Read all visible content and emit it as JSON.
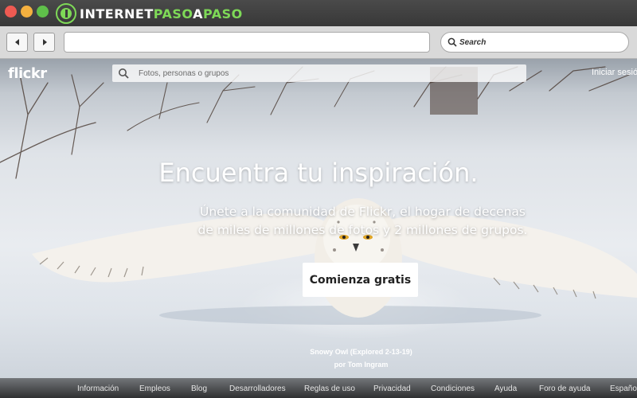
{
  "brand": {
    "name_part1": "INTERNET",
    "name_part2": "PASO",
    "name_part3": "A",
    "name_part4": "PASO",
    "accent_color": "#7ed957"
  },
  "browser": {
    "search_placeholder": "Search"
  },
  "flickr": {
    "logo": "flickr",
    "search_placeholder": "Fotos, personas o grupos",
    "login_label": "Iniciar sesión"
  },
  "hero": {
    "title": "Encuentra tu inspiración.",
    "subtitle_line1": "Únete a la comunidad de Flickr, el hogar de decenas",
    "subtitle_line2": "de miles de millones de fotos y 2 millones de grupos.",
    "cta_label": "Comienza gratis"
  },
  "photo_credit": {
    "title": "Snowy Owl (Explored 2-13-19)",
    "author": "por Tom Ingram"
  },
  "footer": {
    "links": [
      "Información",
      "Empleos",
      "Blog",
      "Desarrolladores",
      "Reglas de uso",
      "Privacidad",
      "Condiciones",
      "Ayuda",
      "Foro de ayuda",
      "Español"
    ]
  }
}
